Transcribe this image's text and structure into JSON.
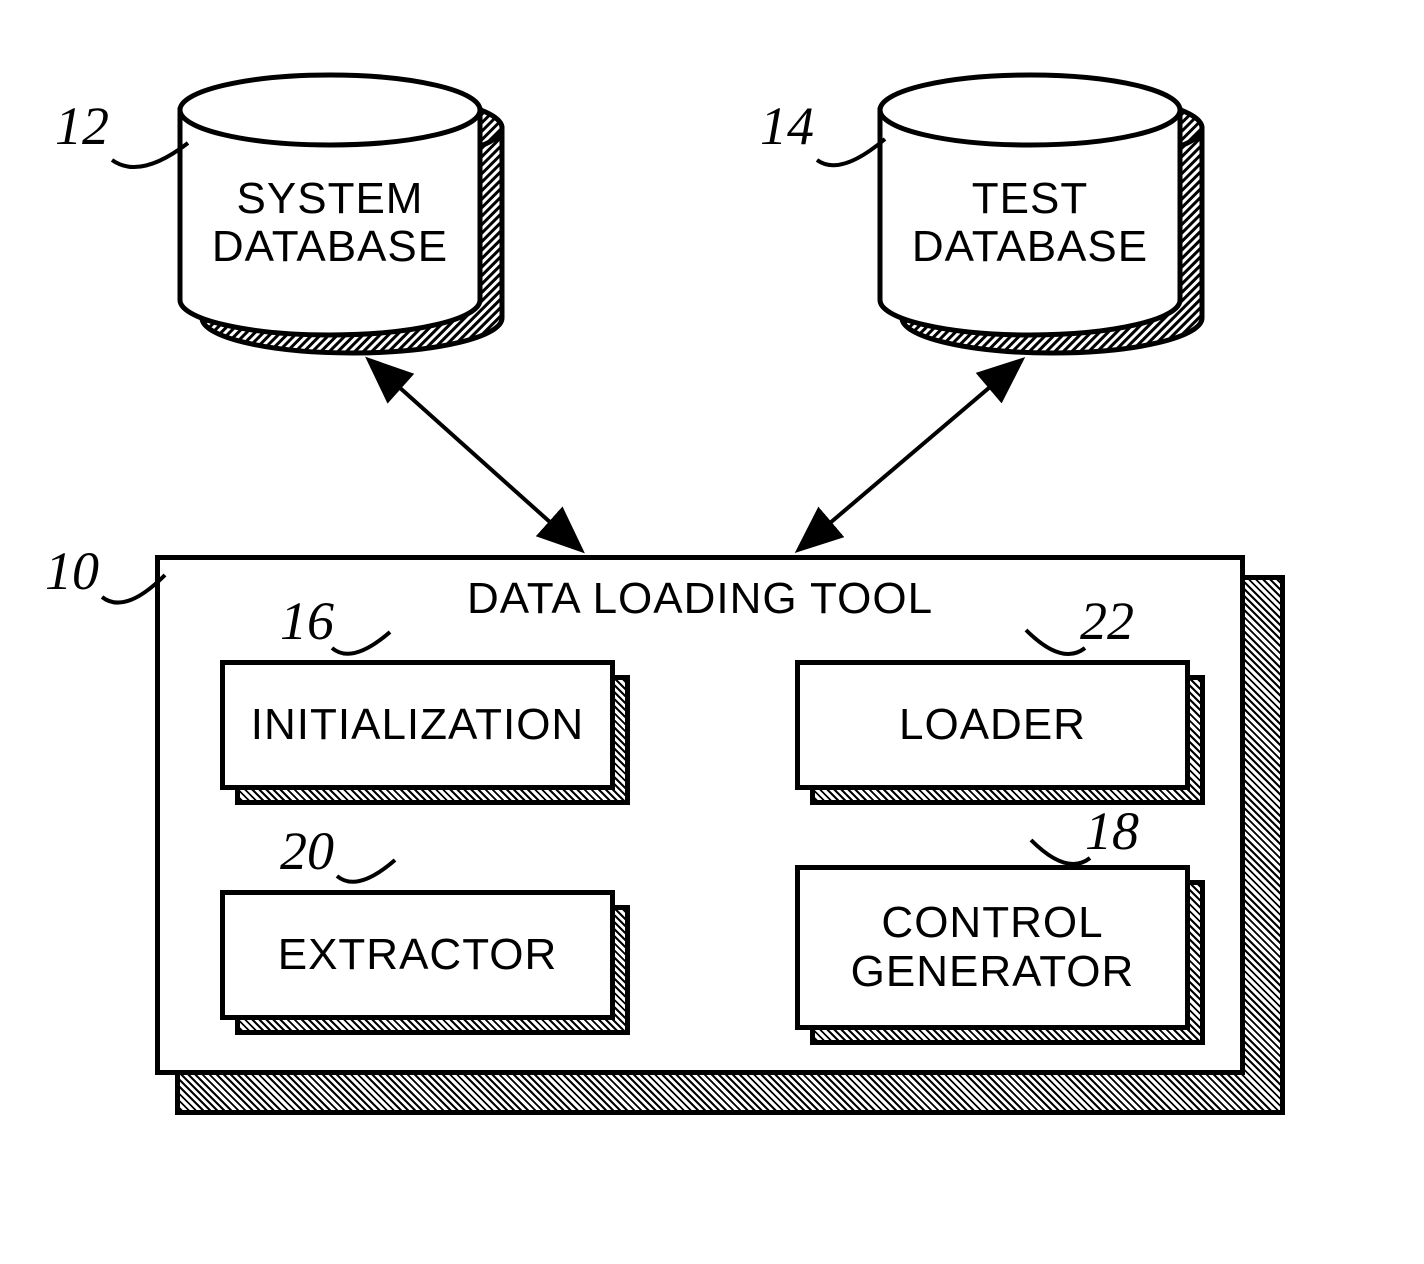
{
  "nodes": {
    "system_db": {
      "ref": "12",
      "label_line1": "SYSTEM",
      "label_line2": "DATABASE"
    },
    "test_db": {
      "ref": "14",
      "label_line1": "TEST",
      "label_line2": "DATABASE"
    },
    "tool": {
      "ref": "10",
      "title": "DATA LOADING TOOL",
      "initialization": {
        "ref": "16",
        "label": "INITIALIZATION"
      },
      "loader": {
        "ref": "22",
        "label": "LOADER"
      },
      "extractor": {
        "ref": "20",
        "label": "EXTRACTOR"
      },
      "control_gen": {
        "ref": "18",
        "label_line1": "CONTROL",
        "label_line2": "GENERATOR"
      }
    }
  }
}
